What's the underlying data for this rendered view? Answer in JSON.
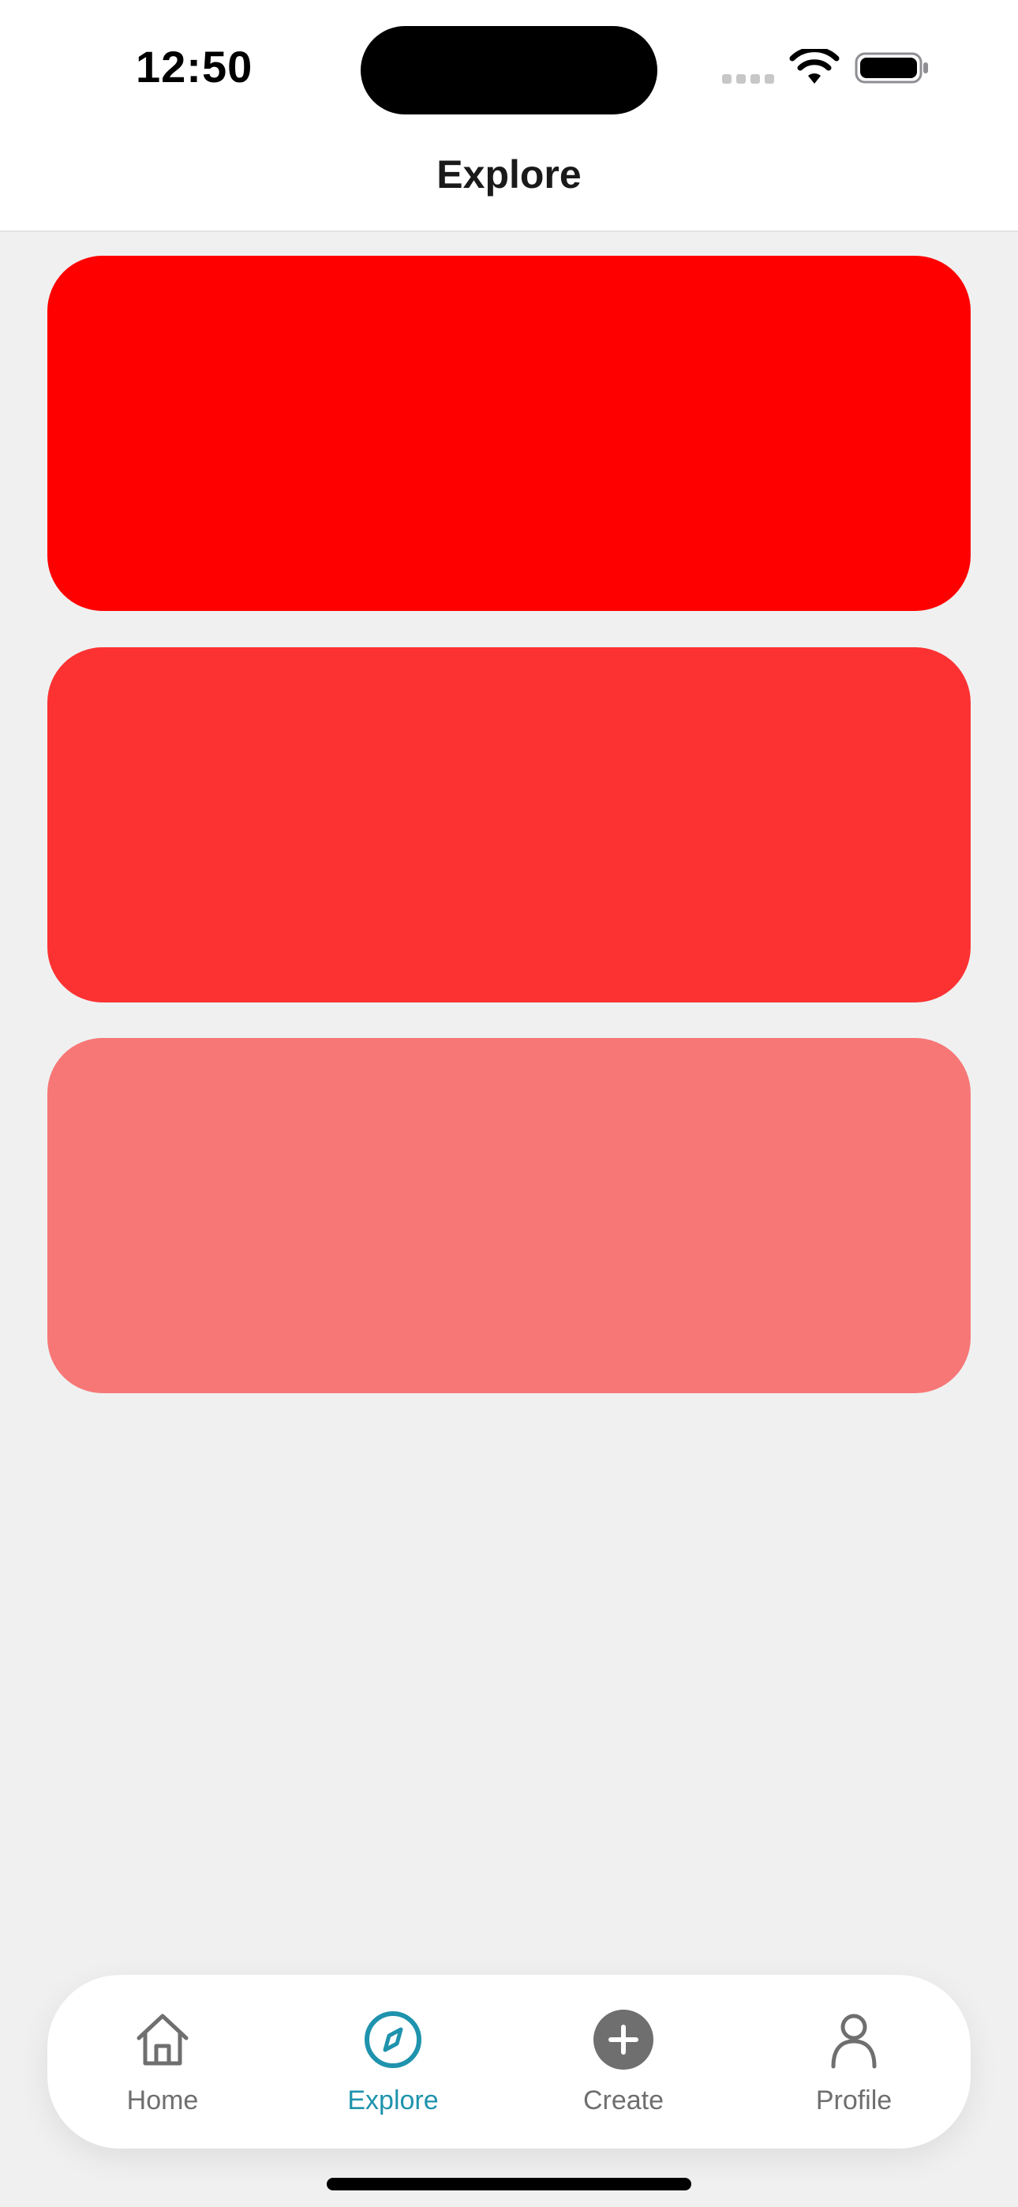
{
  "status_bar": {
    "time": "12:50"
  },
  "header": {
    "title": "Explore"
  },
  "cards": [
    {
      "color": "#ff0000"
    },
    {
      "color": "#fc3232"
    },
    {
      "color": "#f77777"
    }
  ],
  "tab_bar": {
    "items": [
      {
        "label": "Home",
        "icon": "home-icon",
        "active": false
      },
      {
        "label": "Explore",
        "icon": "compass-icon",
        "active": true
      },
      {
        "label": "Create",
        "icon": "plus-circle-icon",
        "active": false
      },
      {
        "label": "Profile",
        "icon": "person-icon",
        "active": false
      }
    ],
    "active_color": "#1f93ad",
    "inactive_color": "#6f6f6f"
  }
}
